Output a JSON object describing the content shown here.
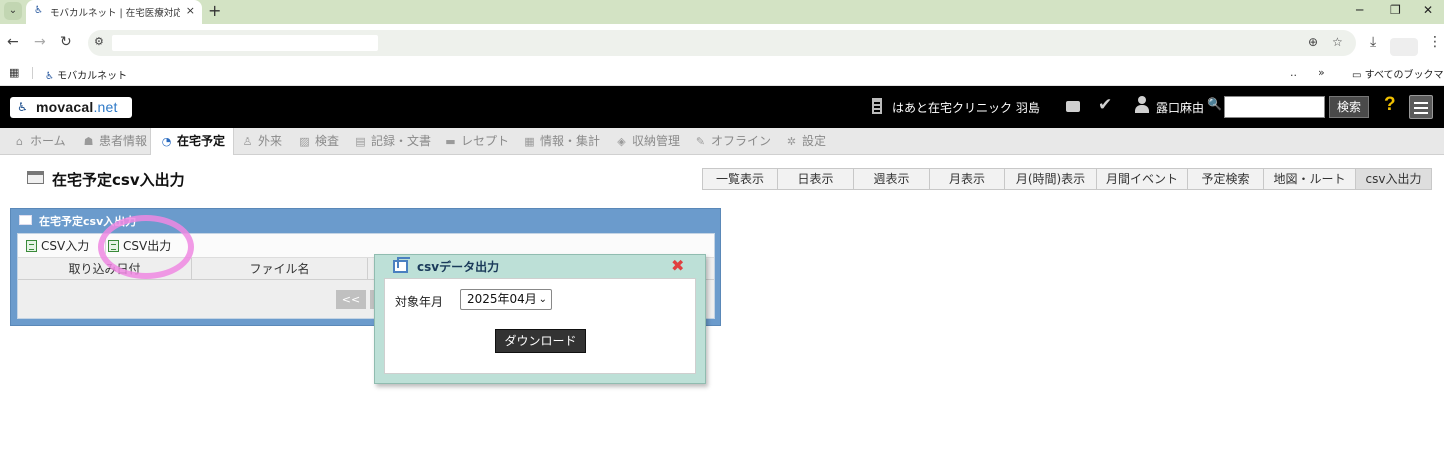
{
  "browser": {
    "tab_title": "モバカルネット | 在宅医療対応電子",
    "tab_close": "×",
    "new_tab": "+",
    "bookmark_label": "モバカルネット",
    "bookmark_overflow": "»",
    "bookmark_dots": "..",
    "all_bookmarks": "すべてのブックマーク"
  },
  "header": {
    "logo_main": "movacal",
    "logo_suffix": ".net",
    "clinic_name": "はあと在宅クリニック 羽島",
    "user_name": "露口麻由",
    "search_value": "",
    "search_button": "検索",
    "help_symbol": "?"
  },
  "nav": {
    "items": [
      {
        "label": "ホーム",
        "icon": "home-icon",
        "glyph": "⌂"
      },
      {
        "label": "患者情報",
        "icon": "patient-icon",
        "glyph": "☗"
      },
      {
        "label": "在宅予定",
        "icon": "clock-icon",
        "glyph": "◔"
      },
      {
        "label": "外来",
        "icon": "person-icon",
        "glyph": "♙"
      },
      {
        "label": "検査",
        "icon": "chart-icon",
        "glyph": "▨"
      },
      {
        "label": "記録・文書",
        "icon": "document-icon",
        "glyph": "▤"
      },
      {
        "label": "レセプト",
        "icon": "receipt-icon",
        "glyph": "▬"
      },
      {
        "label": "情報・集計",
        "icon": "stats-icon",
        "glyph": "▦"
      },
      {
        "label": "収納管理",
        "icon": "tag-icon",
        "glyph": "◈"
      },
      {
        "label": "オフライン",
        "icon": "plug-icon",
        "glyph": "✎"
      },
      {
        "label": "設定",
        "icon": "gear-icon",
        "glyph": "✲"
      }
    ],
    "active_index": 2
  },
  "page": {
    "title": "在宅予定csv入出力",
    "view_tabs": [
      "一覧表示",
      "日表示",
      "週表示",
      "月表示",
      "月(時間)表示",
      "月間イベント",
      "予定検索",
      "地図・ルート",
      "csv入出力"
    ],
    "active_view": 8
  },
  "panel": {
    "title": "在宅予定csv入出力",
    "csv_import": "CSV入力",
    "csv_export": "CSV出力",
    "col_import_date": "取り込み日付",
    "col_file_name": "ファイル名",
    "pager_prev": "<<"
  },
  "dialog": {
    "title": "csvデータ出力",
    "close_symbol": "✖",
    "field_label": "対象年月",
    "selected_month": "2025年04月",
    "download_button": "ダウンロード"
  },
  "colors": {
    "header_bg": "#000000",
    "panel_blue": "#6b9bcc",
    "dialog_green": "#bde0d7",
    "highlight_pink": "#ee88e2",
    "help_yellow": "#f0c000"
  }
}
